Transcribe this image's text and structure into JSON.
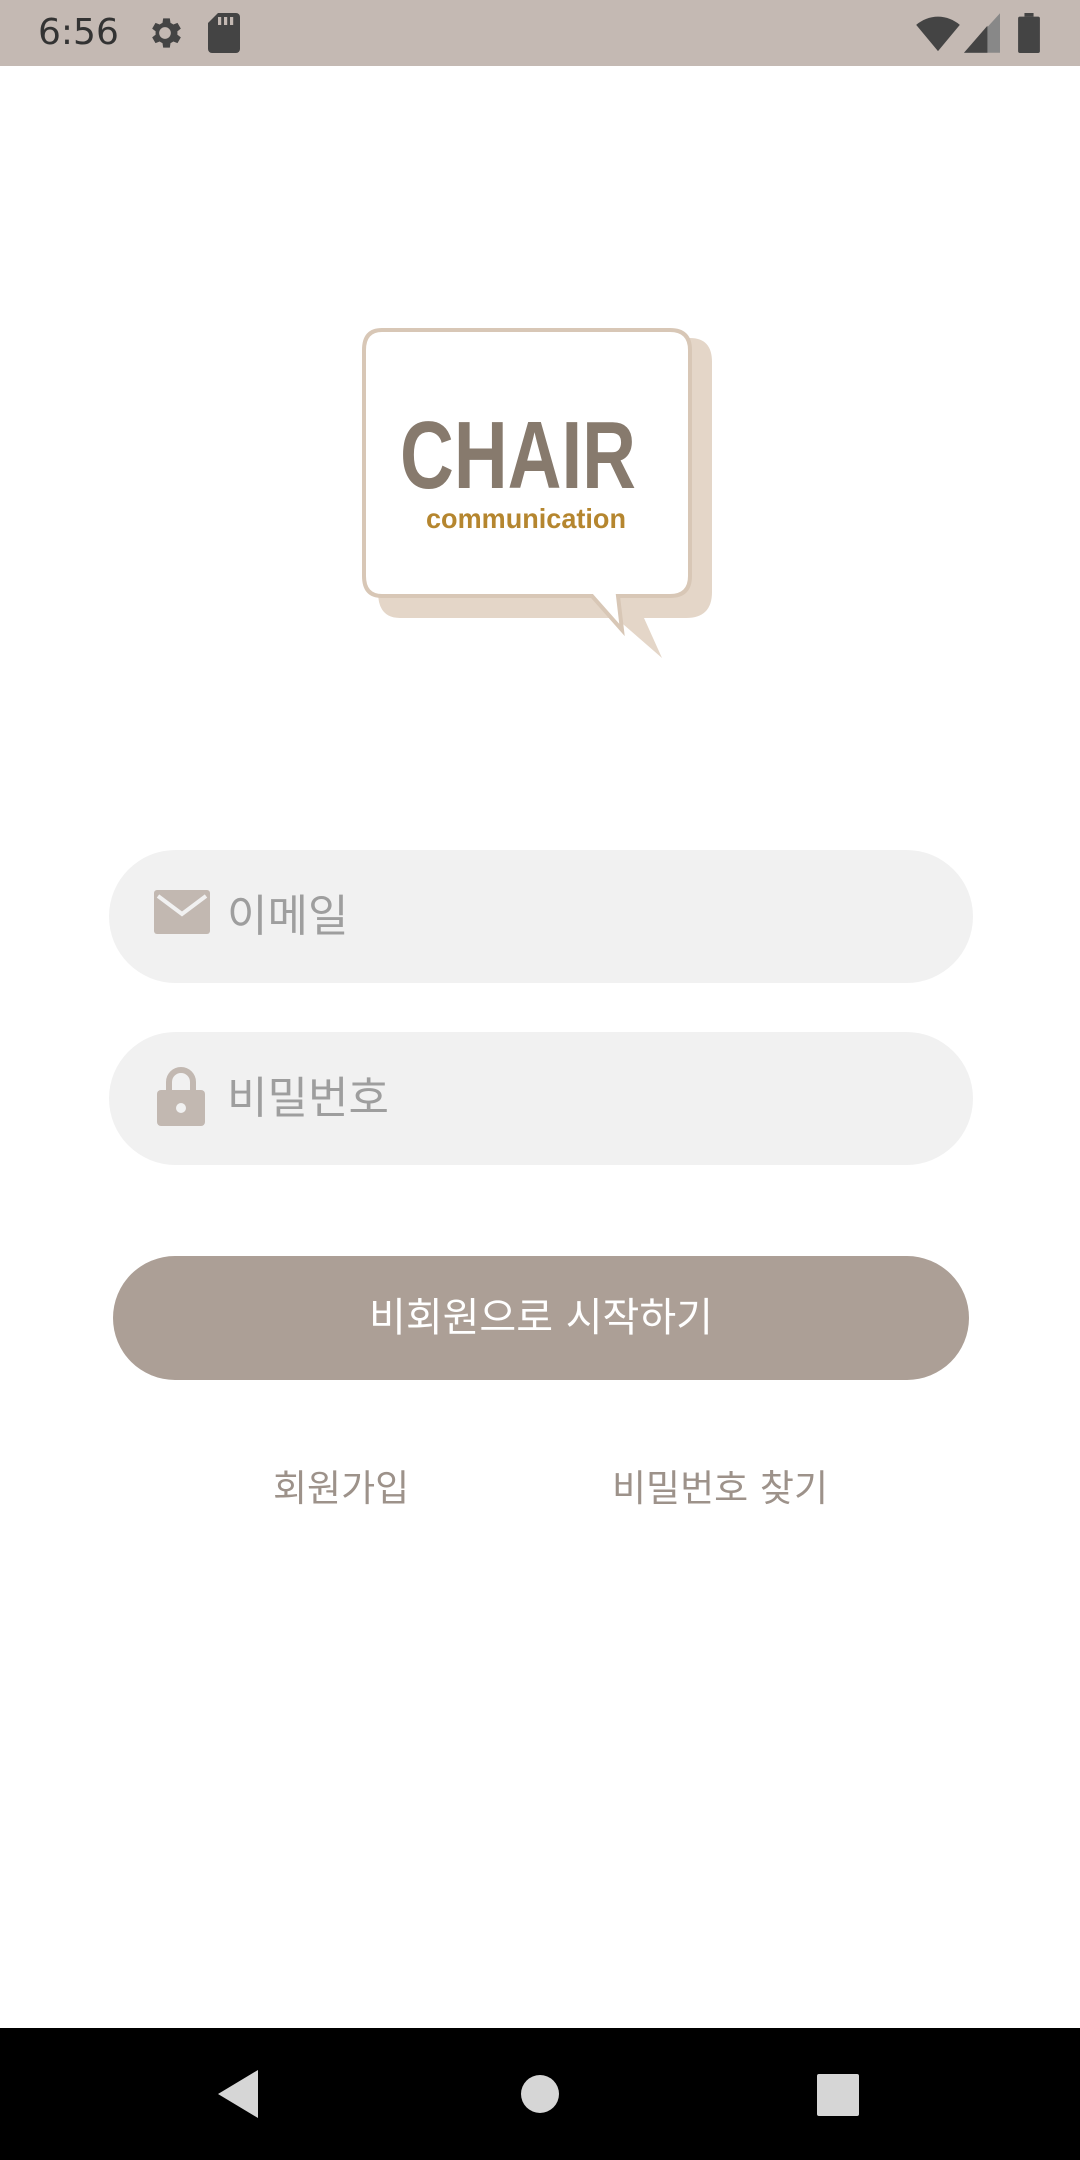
{
  "status_bar": {
    "time": "6:56",
    "icons": [
      "gear-icon",
      "sd-card-icon",
      "wifi-icon",
      "signal-icon",
      "battery-icon"
    ],
    "background": "#c4b9b3"
  },
  "logo": {
    "title": "CHAIR",
    "subtitle": "communication",
    "title_color": "#877a6d",
    "subtitle_color": "#b5862f",
    "bubble_shadow": "#e4d6c8"
  },
  "login": {
    "email_placeholder": "이메일",
    "password_placeholder": "비밀번호",
    "email_icon": "mail-icon",
    "password_icon": "lock-icon",
    "guest_button_label": "비회원으로 시작하기",
    "signup_label": "회원가입",
    "find_password_label": "비밀번호 찾기"
  },
  "colors": {
    "accent": "#ac9f96",
    "field_background": "#f1f1f1",
    "placeholder": "#9e9e9e",
    "link": "#9d928a"
  },
  "nav_bar": {
    "icons": [
      "back-icon",
      "home-icon",
      "recents-icon"
    ]
  }
}
